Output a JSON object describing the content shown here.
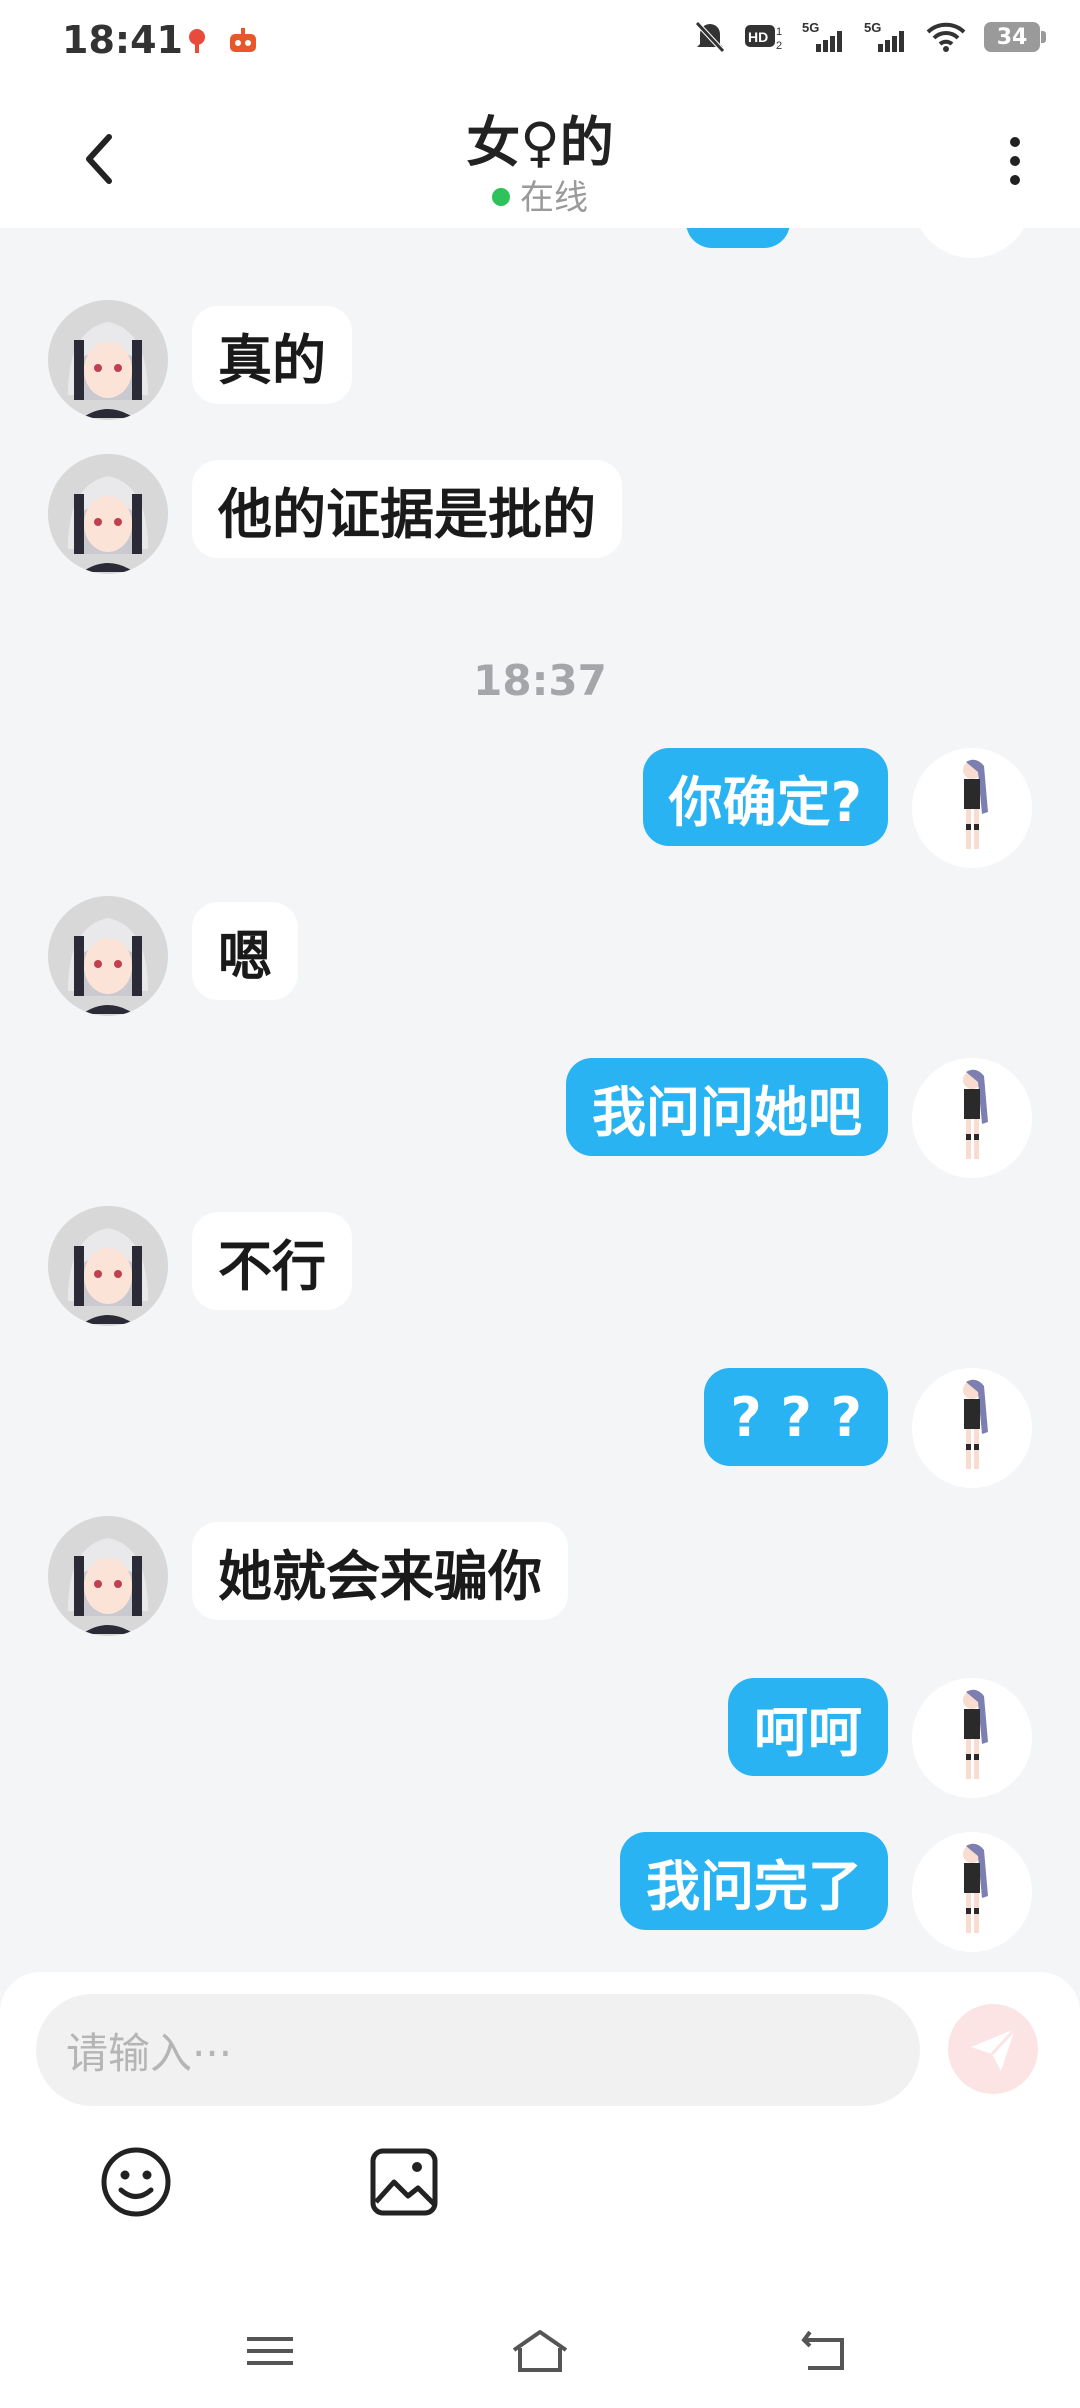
{
  "status_bar": {
    "time": "18:41",
    "battery": "34"
  },
  "header": {
    "title": "女♀的",
    "presence": "在线"
  },
  "chat": {
    "time_separator": "18:37",
    "messages": [
      {
        "side": "left",
        "text": "真的"
      },
      {
        "side": "left",
        "text": "他的证据是批的"
      },
      {
        "side": "right",
        "text": "你确定?"
      },
      {
        "side": "left",
        "text": "嗯"
      },
      {
        "side": "right",
        "text": "我问问她吧"
      },
      {
        "side": "left",
        "text": "不行"
      },
      {
        "side": "right",
        "text": "? ? ?"
      },
      {
        "side": "left",
        "text": "她就会来骗你"
      },
      {
        "side": "right",
        "text": "呵呵"
      },
      {
        "side": "right",
        "text": "我问完了"
      }
    ]
  },
  "input": {
    "placeholder": "请输入···"
  },
  "toolbar": {
    "emoji_icon": "smile-icon",
    "image_icon": "image-icon"
  },
  "nav": {
    "menu_icon": "menu-icon",
    "home_icon": "home-icon",
    "back_icon": "back-icon"
  },
  "colors": {
    "outgoing_bubble": "#29b3f3",
    "incoming_bubble": "#ffffff",
    "background": "#f4f5f7",
    "online": "#2ec25a",
    "send_button": "#fde4e4"
  }
}
